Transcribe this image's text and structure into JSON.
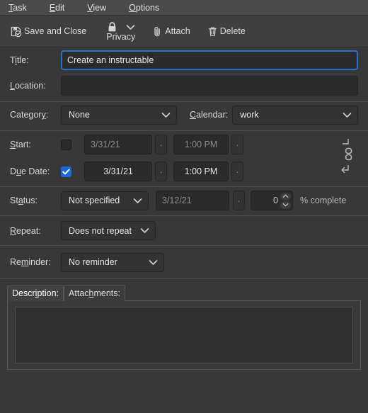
{
  "menubar": {
    "items": [
      {
        "label": "Task",
        "mnemonic": "T",
        "name": "menu-task"
      },
      {
        "label": "Edit",
        "mnemonic": "E",
        "name": "menu-edit"
      },
      {
        "label": "View",
        "mnemonic": "V",
        "name": "menu-view"
      },
      {
        "label": "Options",
        "mnemonic": "O",
        "name": "menu-options"
      }
    ]
  },
  "toolbar": {
    "save_and_close": "Save and Close",
    "privacy": "Privacy",
    "attach": "Attach",
    "delete": "Delete"
  },
  "form": {
    "title_label": "Title:",
    "title_label_pre": "T",
    "title_label_mn": "i",
    "title_label_post": "tle:",
    "title_value": "Create an instructable",
    "location_label": "Location:",
    "location_mn": "L",
    "location_post": "ocation:",
    "location_value": "",
    "category_label": "Category:",
    "category_pre": "Categor",
    "category_mn": "y",
    "category_post": ":",
    "category_value": "None",
    "calendar_label": "Calendar:",
    "calendar_mn": "C",
    "calendar_post": "alendar:",
    "calendar_value": "work",
    "start_label": "Start:",
    "start_mn": "S",
    "start_post": "tart:",
    "start_checked": false,
    "start_date": "3/31/21",
    "start_time": "1:00 PM",
    "due_label": "Due Date:",
    "due_pre": "D",
    "due_mn": "u",
    "due_post": "e Date:",
    "due_checked": true,
    "due_date": "3/31/21",
    "due_time": "1:00 PM",
    "status_label": "Status:",
    "status_pre": "St",
    "status_mn": "a",
    "status_post": "tus:",
    "status_value": "Not specified",
    "completed_date": "3/12/21",
    "percent_complete": "0",
    "percent_label": "% complete",
    "repeat_label": "Repeat:",
    "repeat_mn": "R",
    "repeat_post": "epeat:",
    "repeat_value": "Does not repeat",
    "reminder_label": "Reminder:",
    "reminder_pre": "Re",
    "reminder_mn": "m",
    "reminder_post": "inder:",
    "reminder_value": "No reminder",
    "dot_button": "·"
  },
  "tabs": [
    {
      "label": "Description:",
      "pre": "Descr",
      "mn": "i",
      "post": "ption:",
      "active": true,
      "name": "tab-description"
    },
    {
      "label": "Attachments:",
      "pre": "Attac",
      "mn": "h",
      "post": "ments:",
      "active": false,
      "name": "tab-attachments"
    }
  ],
  "description": {
    "value": ""
  },
  "colors": {
    "window_bg": "#383838",
    "menubar_bg": "#4a4a4a",
    "toolbar_bg": "#3f3f3f",
    "field_bg": "#2b2b2b",
    "accent_blue": "#1b68d0",
    "focus_border": "#2a6fc9",
    "text": "#d4d4d4",
    "muted_text": "#8a8a8a"
  }
}
